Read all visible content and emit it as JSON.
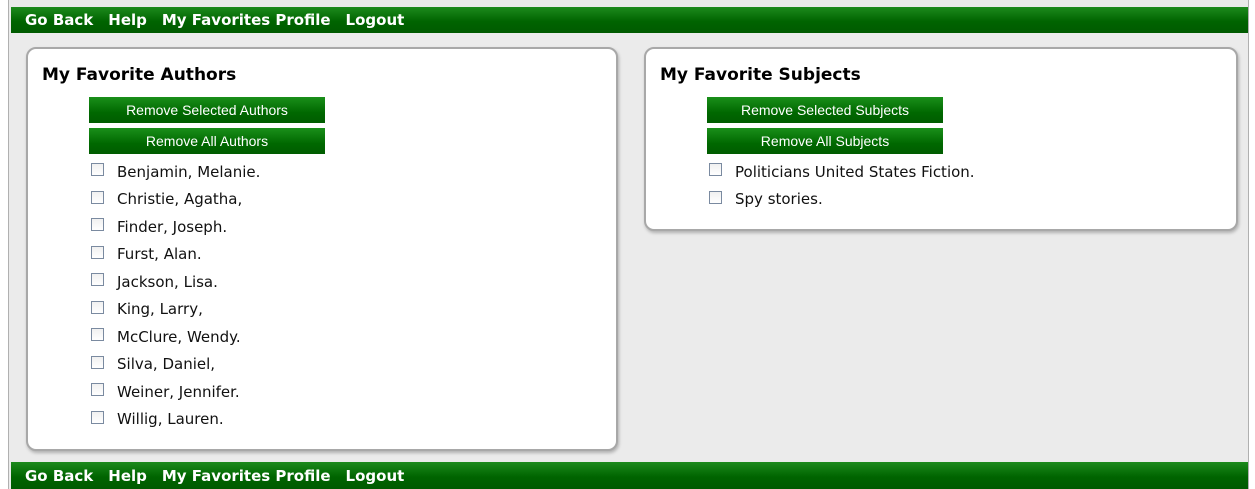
{
  "nav": {
    "links": [
      "Go Back",
      "Help",
      "My Favorites Profile",
      "Logout"
    ]
  },
  "authors": {
    "title": "My Favorite Authors",
    "remove_selected_label": "Remove Selected Authors",
    "remove_all_label": "Remove All Authors",
    "items": [
      "Benjamin, Melanie.",
      "Christie, Agatha,",
      "Finder, Joseph.",
      "Furst, Alan.",
      "Jackson, Lisa.",
      "King, Larry,",
      "McClure, Wendy.",
      "Silva, Daniel,",
      "Weiner, Jennifer.",
      "Willig, Lauren."
    ]
  },
  "subjects": {
    "title": "My Favorite Subjects",
    "remove_selected_label": "Remove Selected Subjects",
    "remove_all_label": "Remove All Subjects",
    "items": [
      "Politicians United States Fiction.",
      "Spy stories."
    ]
  },
  "colors": {
    "nav_green": "#006400",
    "button_green": "#006800",
    "page_background": "#ebebeb"
  }
}
